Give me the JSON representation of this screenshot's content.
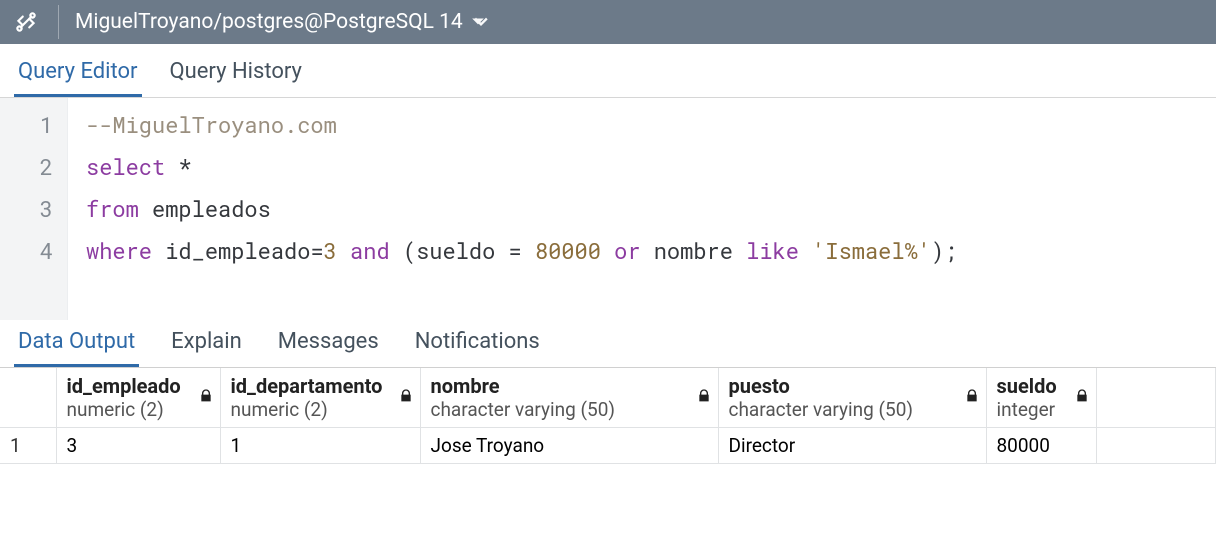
{
  "titlebar": {
    "connection": "MiguelTroyano/postgres@PostgreSQL 14"
  },
  "tabs": {
    "editor": "Query Editor",
    "history": "Query History"
  },
  "editor": {
    "lines": [
      "1",
      "2",
      "3",
      "4"
    ],
    "tokens": {
      "l1_comment": "--MiguelTroyano.com",
      "l2_select": "select",
      "l2_star": " *",
      "l3_from": "from",
      "l3_tbl": " empleados",
      "l4_where": "where",
      "l4_a": " id_empleado=",
      "l4_n1": "3",
      "l4_and": " and ",
      "l4_p1": "(sueldo = ",
      "l4_n2": "80000",
      "l4_or": " or ",
      "l4_c": "nombre ",
      "l4_like": "like",
      "l4_sp": " ",
      "l4_str": "'Ismael%'",
      "l4_end": ");"
    }
  },
  "result_tabs": {
    "data": "Data Output",
    "explain": "Explain",
    "messages": "Messages",
    "notifications": "Notifications"
  },
  "columns": [
    {
      "name": "id_empleado",
      "type": "numeric (2)"
    },
    {
      "name": "id_departamento",
      "type": "numeric (2)"
    },
    {
      "name": "nombre",
      "type": "character varying (50)"
    },
    {
      "name": "puesto",
      "type": "character varying (50)"
    },
    {
      "name": "sueldo",
      "type": "integer"
    }
  ],
  "rows": [
    {
      "n": "1",
      "cells": [
        "3",
        "1",
        "Jose Troyano",
        "Director",
        "80000"
      ]
    }
  ]
}
